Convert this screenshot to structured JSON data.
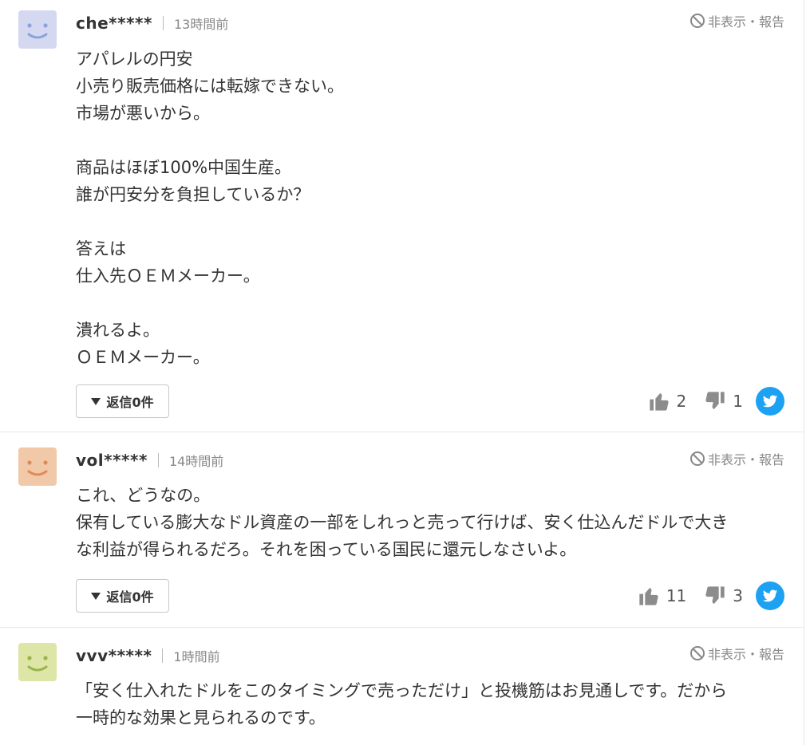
{
  "comments": [
    {
      "username": "che*****",
      "time": "13時間前",
      "hide_report": "非表示・報告",
      "avatar_color": "#d4d9f1",
      "avatar_face_color": "#8ea2d9",
      "lines": [
        "アパレルの円安",
        "小売り販売価格には転嫁できない。",
        "市場が悪いから。",
        "",
        "商品はほぼ100%中国生産。",
        "誰が円安分を負担しているか？",
        "",
        "答えは",
        "仕入先ＯＥＭメーカー。",
        "",
        "潰れるよ。",
        "ＯＥＭメーカー。"
      ],
      "reply_label": "返信",
      "reply_count": "0件",
      "likes": "2",
      "dislikes": "1"
    },
    {
      "username": "vol*****",
      "time": "14時間前",
      "hide_report": "非表示・報告",
      "avatar_color": "#f1c8a8",
      "avatar_face_color": "#e08a57",
      "lines": [
        "これ、どうなの。",
        "保有している膨大なドル資産の一部をしれっと売って行けば、安く仕込んだドルで大き",
        "な利益が得られるだろ。それを困っている国民に還元しなさいよ。"
      ],
      "reply_label": "返信",
      "reply_count": "0件",
      "likes": "11",
      "dislikes": "3"
    },
    {
      "username": "vvv*****",
      "time": "1時間前",
      "hide_report": "非表示・報告",
      "avatar_color": "#dde6a6",
      "avatar_face_color": "#9ab34e",
      "lines": [
        "「安く仕入れたドルをこのタイミングで売っただけ」と投機筋はお見通しです。だから",
        "一時的な効果と見られるのです。"
      ]
    }
  ],
  "icons": {
    "hide": "prohibit-icon",
    "reply_toggle": "triangle-down-icon",
    "like": "thumbs-up-icon",
    "dislike": "thumbs-down-icon",
    "share": "twitter-icon"
  },
  "colors": {
    "twitter": "#1da1f2",
    "vote_icon": "#8c8c8c"
  }
}
